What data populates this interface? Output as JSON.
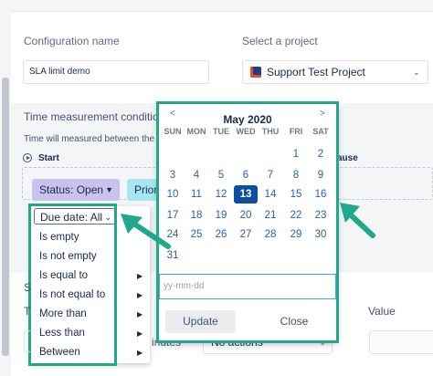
{
  "config": {
    "name_label": "Configuration name",
    "name_value": "SLA limit demo",
    "project_label": "Select a project",
    "project_value": "Support Test Project"
  },
  "time_section": {
    "title": "Time measurement condition",
    "subtitle": "Time will measured between the S",
    "start_label": "Start",
    "pause_label": "ause"
  },
  "filters": {
    "status_label": "Status: Open",
    "priority_label": "Prior"
  },
  "due_dropdown": {
    "head_label": "Due date: All",
    "items": [
      {
        "label": "Is empty",
        "submenu": false
      },
      {
        "label": "Is not empty",
        "submenu": false
      },
      {
        "label": "Is equal to",
        "submenu": true
      },
      {
        "label": "Is not equal to",
        "submenu": true
      },
      {
        "label": "More than",
        "submenu": true
      },
      {
        "label": "Less than",
        "submenu": true
      },
      {
        "label": "Between",
        "submenu": true
      }
    ]
  },
  "calendar": {
    "month_label": "May 2020",
    "prev_icon": "<",
    "next_icon": ">",
    "weekdays": [
      "SUN",
      "MON",
      "TUE",
      "WED",
      "THU",
      "FRI",
      "SAT"
    ],
    "weeks": [
      [
        "",
        "",
        "",
        "",
        "",
        "1",
        "2"
      ],
      [
        "3",
        "4",
        "5",
        "6",
        "7",
        "8",
        "9"
      ],
      [
        "10",
        "11",
        "12",
        "13",
        "14",
        "15",
        "16"
      ],
      [
        "17",
        "18",
        "19",
        "20",
        "21",
        "22",
        "23"
      ],
      [
        "24",
        "25",
        "26",
        "27",
        "28",
        "29",
        "30"
      ],
      [
        "31",
        "",
        "",
        "",
        "",
        "",
        ""
      ]
    ],
    "selected_day": "13",
    "input_placeholder": "yy-mm-dd",
    "update_label": "Update",
    "close_label": "Close"
  },
  "bottom": {
    "value_label": "Value",
    "minutes_text": "inutes",
    "actions_value": "No actions",
    "s_label": "S",
    "t_label": "T"
  },
  "colors": {
    "accent_teal": "#21a88a",
    "selected_day_bg": "#0c4ea2",
    "status_pill": "#c8c3ee",
    "priority_pill": "#a8e6ef"
  }
}
